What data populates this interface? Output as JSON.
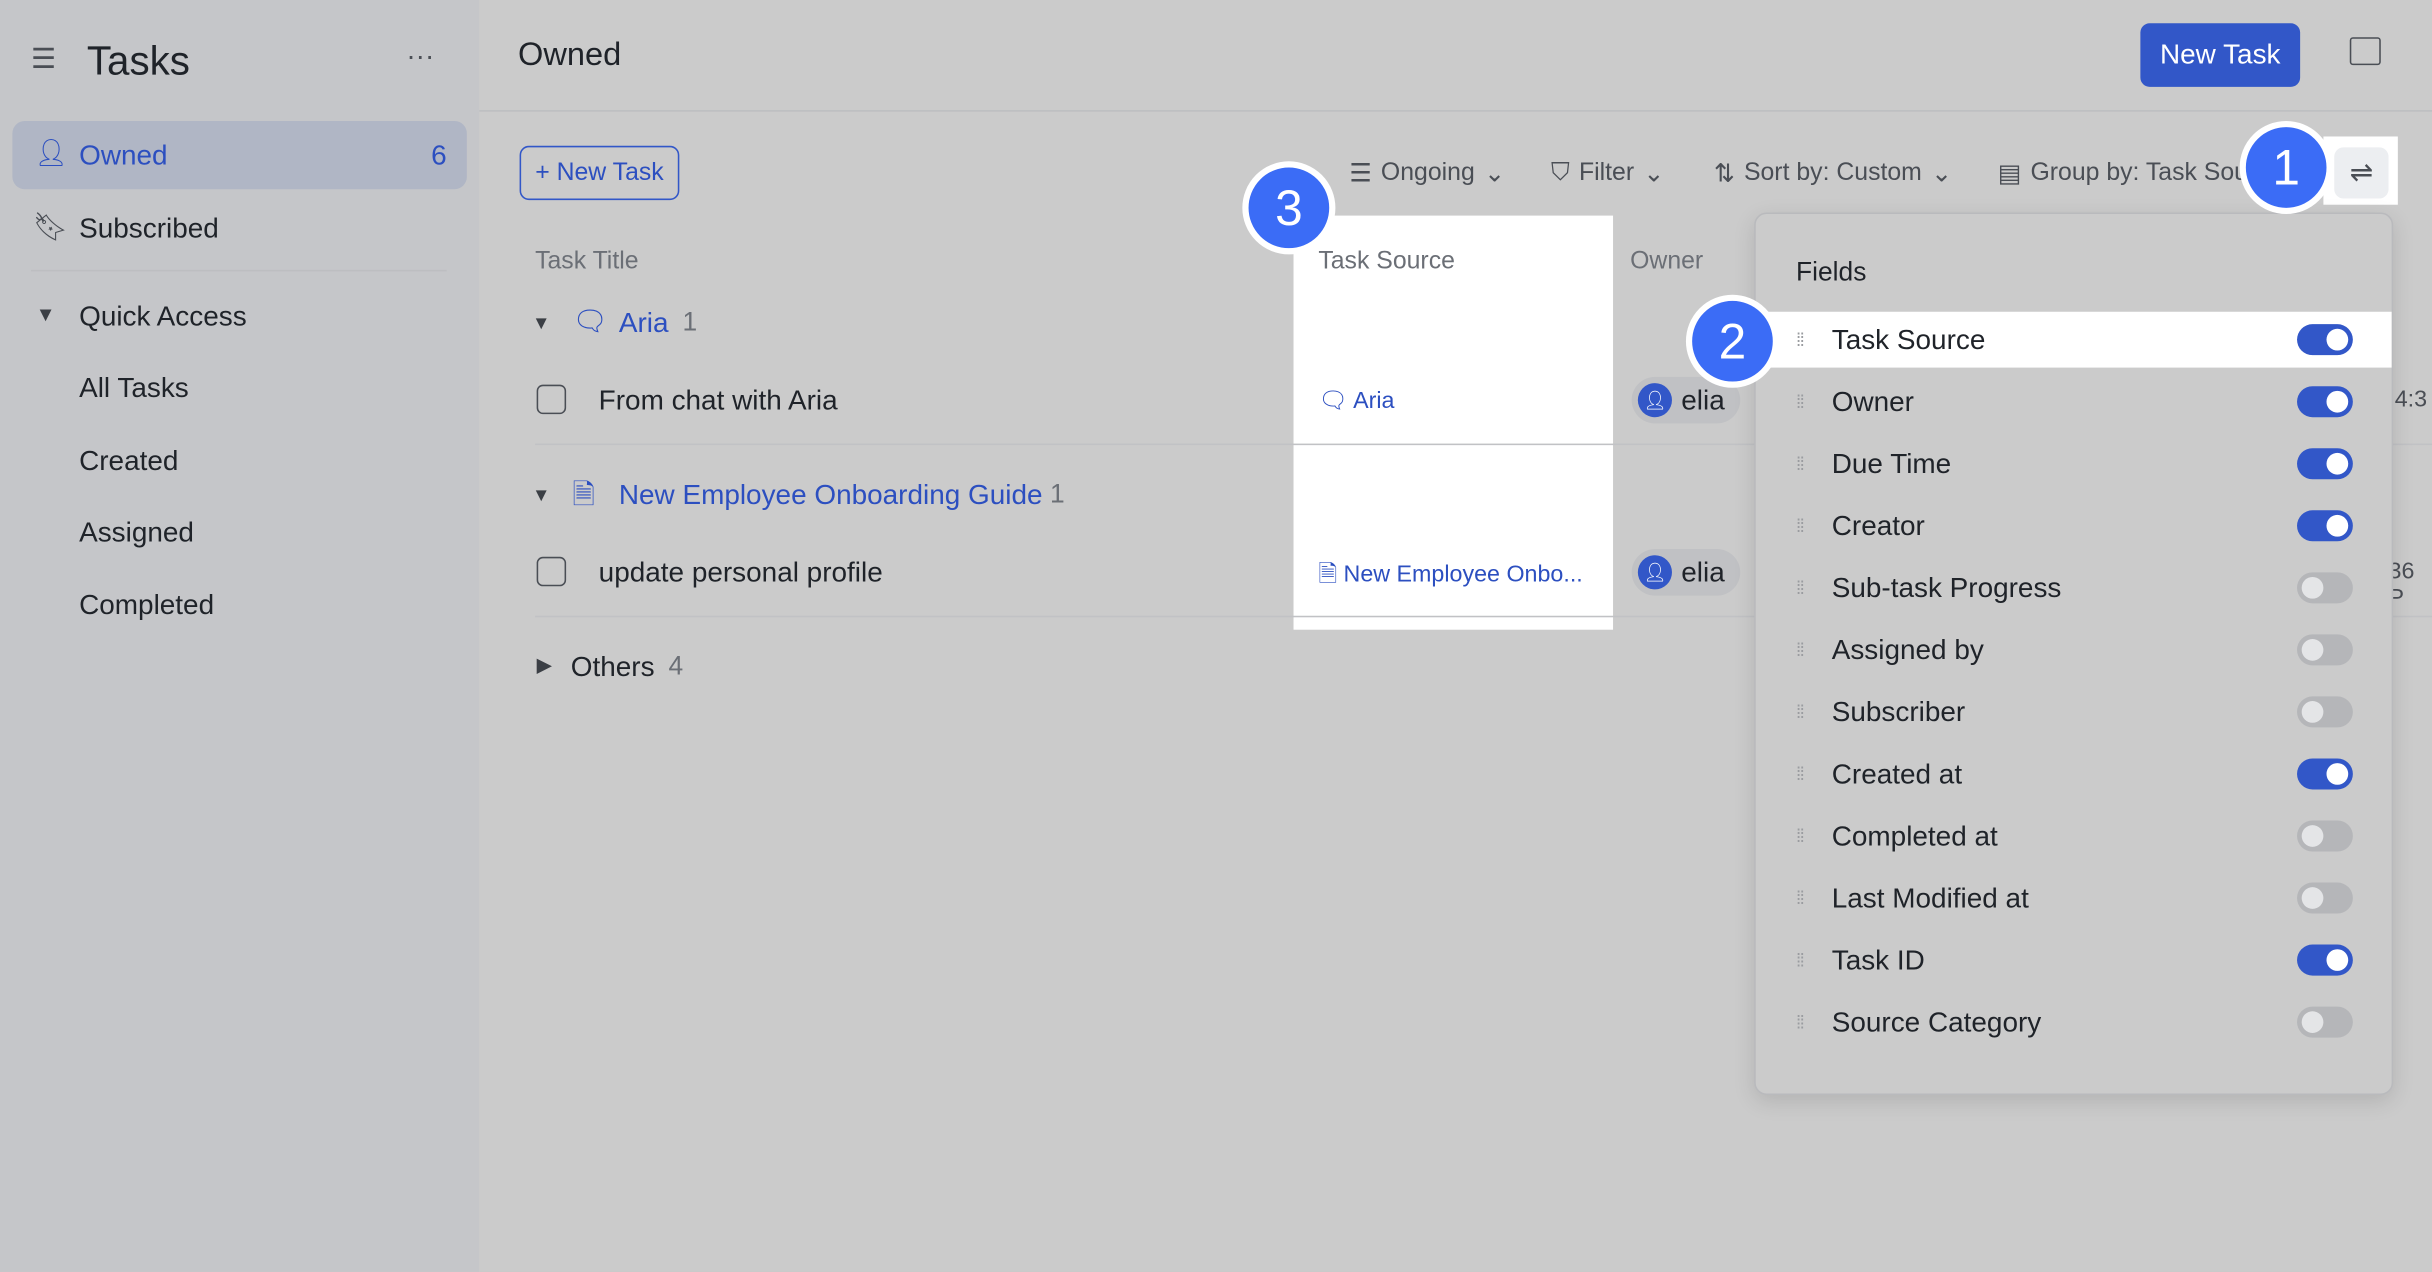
{
  "sidebar": {
    "title": "Tasks",
    "more": "···",
    "items": [
      {
        "label": "Owned",
        "count": "6",
        "icon": "user-icon"
      },
      {
        "label": "Subscribed",
        "icon": "bookmark-icon"
      }
    ],
    "quick_access": {
      "label": "Quick Access",
      "items": [
        "All Tasks",
        "Created",
        "Assigned",
        "Completed"
      ]
    }
  },
  "header": {
    "title": "Owned",
    "new_task": "New Task"
  },
  "toolbar": {
    "new_task": "+ New Task",
    "ongoing": "Ongoing",
    "filter": "Filter",
    "sort": "Sort by: Custom",
    "group": "Group by: Task Sou"
  },
  "table": {
    "columns": [
      "Task Title",
      "Task Source",
      "Owner"
    ],
    "groups": [
      {
        "name": "Aria",
        "count": "1",
        "icon": "chat-icon",
        "tasks": [
          {
            "title": "From chat with Aria",
            "source": "Aria",
            "owner": "elia",
            "extra": "4:3"
          }
        ]
      },
      {
        "name": "New Employee Onboarding Guide",
        "count": "1",
        "icon": "doc-icon",
        "tasks": [
          {
            "title": "update personal profile",
            "source": "New Employee Onbo...",
            "owner": "elia",
            "extra": "36 P"
          }
        ]
      },
      {
        "name": "Others",
        "count": "4"
      }
    ]
  },
  "fields_panel": {
    "title": "Fields",
    "fields": [
      {
        "label": "Task Source",
        "on": true
      },
      {
        "label": "Owner",
        "on": true
      },
      {
        "label": "Due Time",
        "on": true
      },
      {
        "label": "Creator",
        "on": true
      },
      {
        "label": "Sub-task Progress",
        "on": false
      },
      {
        "label": "Assigned by",
        "on": false
      },
      {
        "label": "Subscriber",
        "on": false
      },
      {
        "label": "Created at",
        "on": true
      },
      {
        "label": "Completed at",
        "on": false
      },
      {
        "label": "Last Modified at",
        "on": false
      },
      {
        "label": "Task ID",
        "on": true
      },
      {
        "label": "Source Category",
        "on": false
      }
    ]
  },
  "markers": [
    "1",
    "2",
    "3"
  ],
  "colors": {
    "accent": "#3257c8",
    "marker": "#3b6cf6"
  }
}
